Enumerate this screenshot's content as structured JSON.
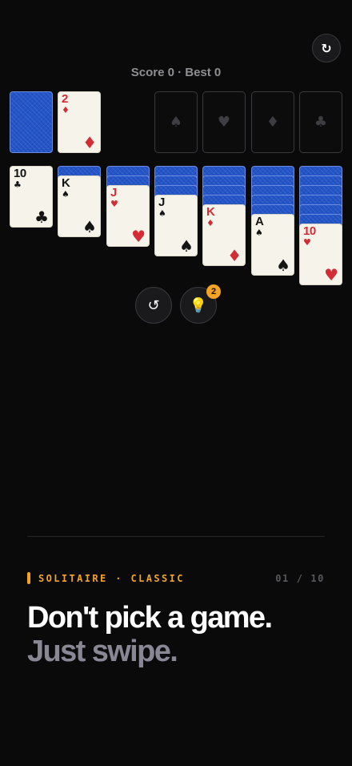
{
  "header": {
    "restart_icon": "↻",
    "score_text": "Score 0 · Best 0"
  },
  "colors": {
    "background": "#0a0a0b",
    "card_back": "#2355c9",
    "card_face": "#f6f3ea",
    "red_suit": "#d42c34",
    "black_suit": "#141414",
    "accent": "#f4a422"
  },
  "stock": {
    "icon": "card-back"
  },
  "waste": {
    "rank": "2",
    "suit": "♦",
    "color": "red"
  },
  "foundations": [
    {
      "suit": "♠",
      "icon": "spade-icon"
    },
    {
      "suit": "♥",
      "icon": "heart-icon"
    },
    {
      "suit": "♦",
      "icon": "diamond-icon"
    },
    {
      "suit": "♣",
      "icon": "club-icon"
    }
  ],
  "tableau": [
    {
      "hidden": 0,
      "rank": "10",
      "suit": "♣",
      "color": "black"
    },
    {
      "hidden": 1,
      "rank": "K",
      "suit": "♠",
      "color": "black"
    },
    {
      "hidden": 2,
      "rank": "J",
      "suit": "♥",
      "color": "red"
    },
    {
      "hidden": 3,
      "rank": "J",
      "suit": "♠",
      "color": "black"
    },
    {
      "hidden": 4,
      "rank": "K",
      "suit": "♦",
      "color": "red"
    },
    {
      "hidden": 5,
      "rank": "A",
      "suit": "♠",
      "color": "black"
    },
    {
      "hidden": 6,
      "rank": "10",
      "suit": "♥",
      "color": "red"
    }
  ],
  "controls": {
    "undo_icon": "↺",
    "hint_icon": "💡",
    "hint_badge": "2"
  },
  "footer": {
    "category": "SOLITAIRE · CLASSIC",
    "counter": "01 / 10",
    "headline": "Don't pick a game.",
    "subline": "Just swipe."
  }
}
